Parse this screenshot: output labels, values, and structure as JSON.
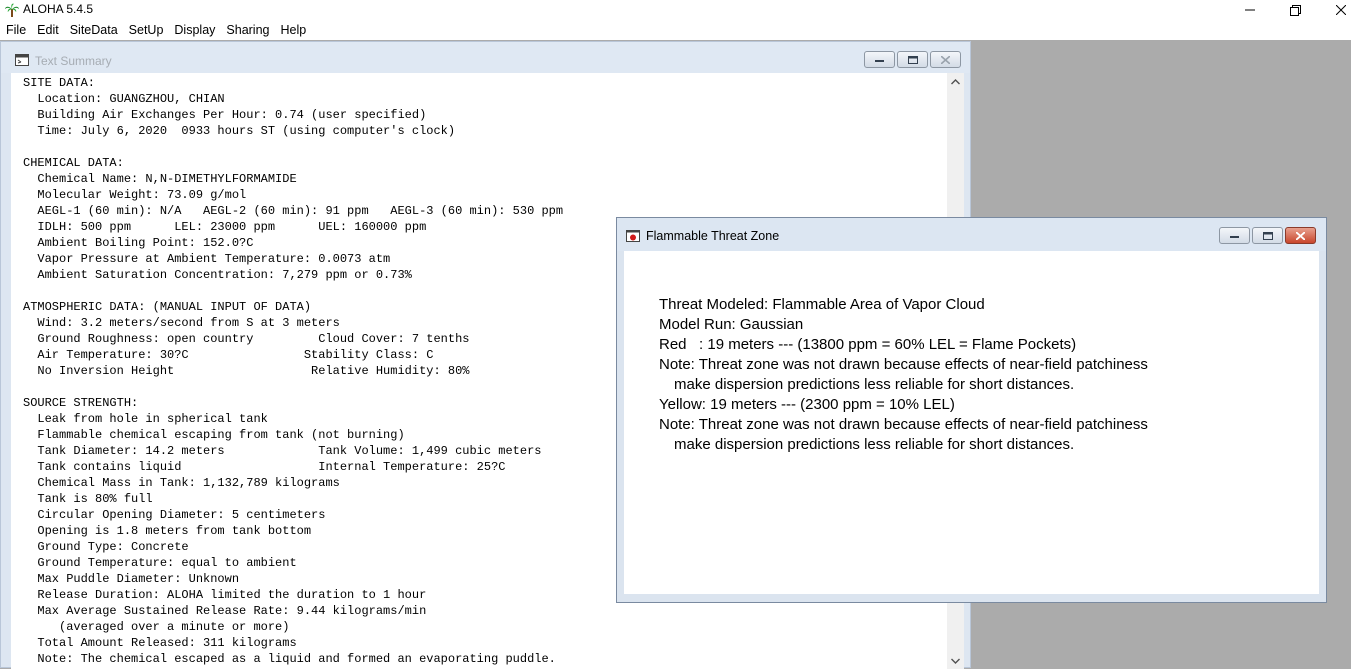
{
  "app": {
    "title": "ALOHA 5.4.5",
    "icon": "palm-tree-icon"
  },
  "menu": [
    "File",
    "Edit",
    "SiteData",
    "SetUp",
    "Display",
    "Sharing",
    "Help"
  ],
  "text_summary": {
    "title": "Text Summary",
    "lines": [
      "SITE DATA:",
      "  Location: GUANGZHOU, CHIAN",
      "  Building Air Exchanges Per Hour: 0.74 (user specified)",
      "  Time: July 6, 2020  0933 hours ST (using computer's clock)",
      "",
      "CHEMICAL DATA:",
      "  Chemical Name: N,N-DIMETHYLFORMAMIDE",
      "  Molecular Weight: 73.09 g/mol",
      "  AEGL-1 (60 min): N/A   AEGL-2 (60 min): 91 ppm   AEGL-3 (60 min): 530 ppm",
      "  IDLH: 500 ppm      LEL: 23000 ppm      UEL: 160000 ppm",
      "  Ambient Boiling Point: 152.0?C",
      "  Vapor Pressure at Ambient Temperature: 0.0073 atm",
      "  Ambient Saturation Concentration: 7,279 ppm or 0.73%",
      "",
      "ATMOSPHERIC DATA: (MANUAL INPUT OF DATA)",
      "  Wind: 3.2 meters/second from S at 3 meters",
      "  Ground Roughness: open country         Cloud Cover: 7 tenths",
      "  Air Temperature: 30?C                Stability Class: C",
      "  No Inversion Height                   Relative Humidity: 80%",
      "",
      "SOURCE STRENGTH:",
      "  Leak from hole in spherical tank",
      "  Flammable chemical escaping from tank (not burning)",
      "  Tank Diameter: 14.2 meters             Tank Volume: 1,499 cubic meters",
      "  Tank contains liquid                   Internal Temperature: 25?C",
      "  Chemical Mass in Tank: 1,132,789 kilograms",
      "  Tank is 80% full",
      "  Circular Opening Diameter: 5 centimeters",
      "  Opening is 1.8 meters from tank bottom",
      "  Ground Type: Concrete",
      "  Ground Temperature: equal to ambient",
      "  Max Puddle Diameter: Unknown",
      "  Release Duration: ALOHA limited the duration to 1 hour",
      "  Max Average Sustained Release Rate: 9.44 kilograms/min",
      "     (averaged over a minute or more)",
      "  Total Amount Released: 311 kilograms",
      "  Note: The chemical escaped as a liquid and formed an evaporating puddle."
    ]
  },
  "threat_zone": {
    "title": "Flammable Threat Zone",
    "lines": [
      {
        "text": "Threat Modeled: Flammable Area of Vapor Cloud",
        "indent": false
      },
      {
        "text": "Model Run: Gaussian",
        "indent": false
      },
      {
        "text": "Red   : 19 meters --- (13800 ppm = 60% LEL = Flame Pockets)",
        "indent": false
      },
      {
        "text": "Note: Threat zone was not drawn because effects of near-field patchiness",
        "indent": false
      },
      {
        "text": "make dispersion predictions less reliable for short distances.",
        "indent": true
      },
      {
        "text": "Yellow: 19 meters --- (2300 ppm = 10% LEL)",
        "indent": false
      },
      {
        "text": "Note: Threat zone was not drawn because effects of near-field patchiness",
        "indent": false
      },
      {
        "text": "make dispersion predictions less reliable for short distances.",
        "indent": true
      }
    ]
  },
  "colors": {
    "mdi_background": "#ababab",
    "mdi_titlebar": "#dce6f2",
    "close_button": "#c9462c"
  }
}
